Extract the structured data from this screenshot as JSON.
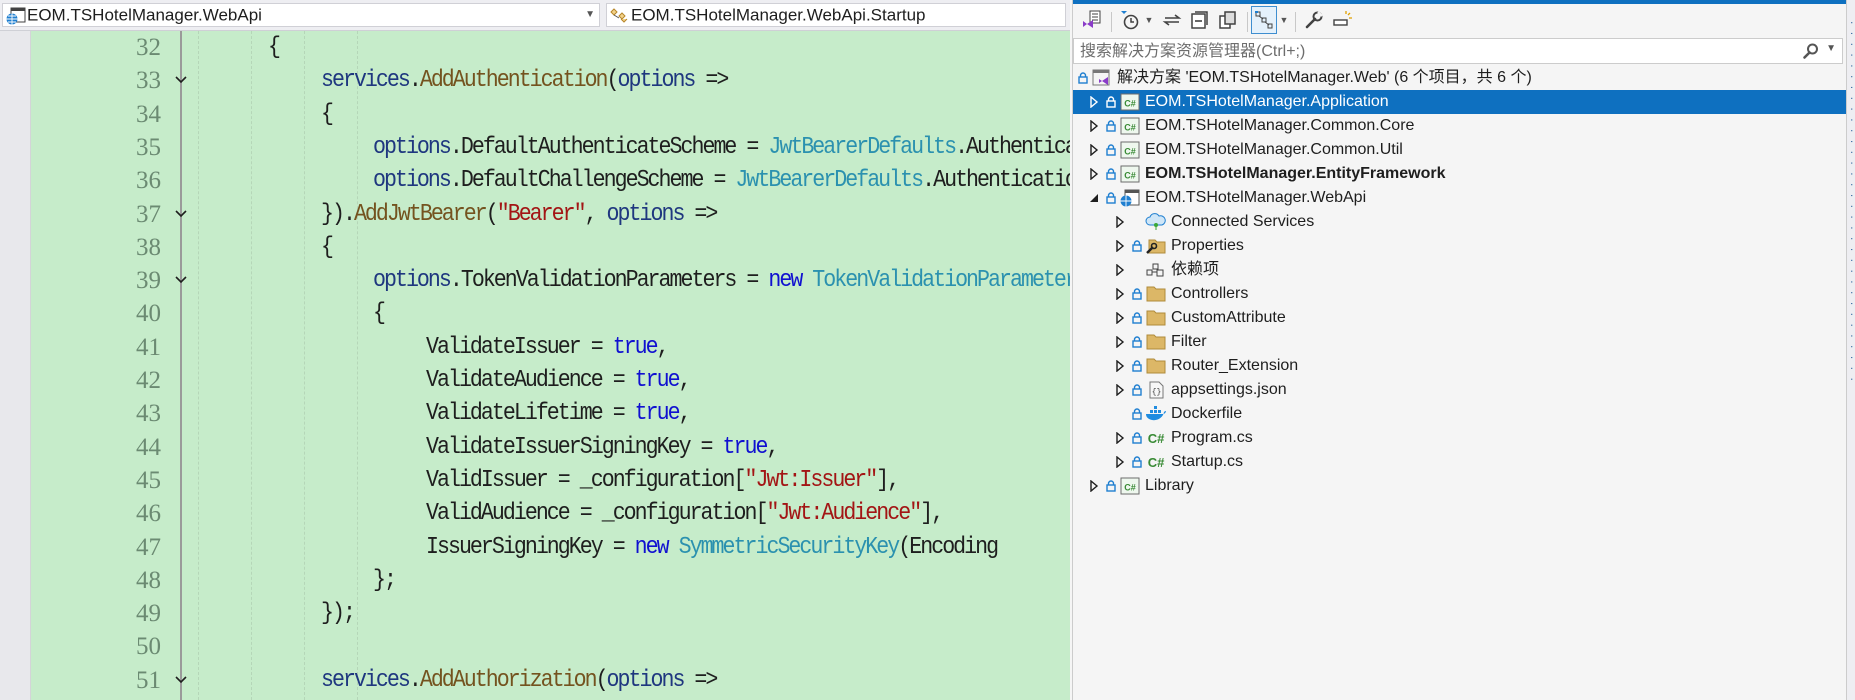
{
  "editor": {
    "nav": {
      "project": "EOM.TSHotelManager.WebApi",
      "class": "EOM.TSHotelManager.WebApi.Startup"
    },
    "lines": [
      {
        "n": "32",
        "fold": false,
        "indent": 3,
        "tokens": [
          {
            "c": "p",
            "t": "{"
          }
        ]
      },
      {
        "n": "33",
        "fold": true,
        "indent": 4,
        "tokens": [
          {
            "c": "v",
            "t": "services"
          },
          {
            "c": "p",
            "t": "."
          },
          {
            "c": "m",
            "t": "AddAuthentication"
          },
          {
            "c": "p",
            "t": "("
          },
          {
            "c": "v",
            "t": "options"
          },
          {
            "c": "p",
            "t": " =>"
          }
        ]
      },
      {
        "n": "34",
        "fold": false,
        "indent": 4,
        "tokens": [
          {
            "c": "p",
            "t": "{"
          }
        ]
      },
      {
        "n": "35",
        "fold": false,
        "indent": 5,
        "tokens": [
          {
            "c": "v",
            "t": "options"
          },
          {
            "c": "p",
            "t": ".DefaultAuthenticateScheme = "
          },
          {
            "c": "t",
            "t": "JwtBearerDefaults"
          },
          {
            "c": "p",
            "t": ".AuthenticationScheme;"
          }
        ]
      },
      {
        "n": "36",
        "fold": false,
        "indent": 5,
        "tokens": [
          {
            "c": "v",
            "t": "options"
          },
          {
            "c": "p",
            "t": ".DefaultChallengeScheme = "
          },
          {
            "c": "t",
            "t": "JwtBearerDefaults"
          },
          {
            "c": "p",
            "t": ".AuthenticationScheme;"
          }
        ]
      },
      {
        "n": "37",
        "fold": true,
        "indent": 4,
        "tokens": [
          {
            "c": "p",
            "t": "})."
          },
          {
            "c": "m",
            "t": "AddJwtBearer"
          },
          {
            "c": "p",
            "t": "("
          },
          {
            "c": "s",
            "t": "\"Bearer\""
          },
          {
            "c": "p",
            "t": ", "
          },
          {
            "c": "v",
            "t": "options"
          },
          {
            "c": "p",
            "t": " =>"
          }
        ]
      },
      {
        "n": "38",
        "fold": false,
        "indent": 4,
        "tokens": [
          {
            "c": "p",
            "t": "{"
          }
        ]
      },
      {
        "n": "39",
        "fold": true,
        "indent": 5,
        "tokens": [
          {
            "c": "v",
            "t": "options"
          },
          {
            "c": "p",
            "t": ".TokenValidationParameters = "
          },
          {
            "c": "k",
            "t": "new"
          },
          {
            "c": "p",
            "t": " "
          },
          {
            "c": "t",
            "t": "TokenValidationParameters"
          }
        ]
      },
      {
        "n": "40",
        "fold": false,
        "indent": 5,
        "tokens": [
          {
            "c": "p",
            "t": "{"
          }
        ]
      },
      {
        "n": "41",
        "fold": false,
        "indent": 6,
        "tokens": [
          {
            "c": "p",
            "t": "ValidateIssuer = "
          },
          {
            "c": "k",
            "t": "true"
          },
          {
            "c": "p",
            "t": ","
          }
        ]
      },
      {
        "n": "42",
        "fold": false,
        "indent": 6,
        "tokens": [
          {
            "c": "p",
            "t": "ValidateAudience = "
          },
          {
            "c": "k",
            "t": "true"
          },
          {
            "c": "p",
            "t": ","
          }
        ]
      },
      {
        "n": "43",
        "fold": false,
        "indent": 6,
        "tokens": [
          {
            "c": "p",
            "t": "ValidateLifetime = "
          },
          {
            "c": "k",
            "t": "true"
          },
          {
            "c": "p",
            "t": ","
          }
        ]
      },
      {
        "n": "44",
        "fold": false,
        "indent": 6,
        "tokens": [
          {
            "c": "p",
            "t": "ValidateIssuerSigningKey = "
          },
          {
            "c": "k",
            "t": "true"
          },
          {
            "c": "p",
            "t": ","
          }
        ]
      },
      {
        "n": "45",
        "fold": false,
        "indent": 6,
        "tokens": [
          {
            "c": "p",
            "t": "ValidIssuer = _configuration["
          },
          {
            "c": "s",
            "t": "\"Jwt:Issuer\""
          },
          {
            "c": "p",
            "t": "],"
          }
        ]
      },
      {
        "n": "46",
        "fold": false,
        "indent": 6,
        "tokens": [
          {
            "c": "p",
            "t": "ValidAudience = _configuration["
          },
          {
            "c": "s",
            "t": "\"Jwt:Audience\""
          },
          {
            "c": "p",
            "t": "],"
          }
        ]
      },
      {
        "n": "47",
        "fold": false,
        "indent": 6,
        "tokens": [
          {
            "c": "p",
            "t": "IssuerSigningKey = "
          },
          {
            "c": "k",
            "t": "new"
          },
          {
            "c": "p",
            "t": " "
          },
          {
            "c": "t",
            "t": "SymmetricSecurityKey"
          },
          {
            "c": "p",
            "t": "(Encoding"
          }
        ]
      },
      {
        "n": "48",
        "fold": false,
        "indent": 5,
        "tokens": [
          {
            "c": "p",
            "t": "};"
          }
        ]
      },
      {
        "n": "49",
        "fold": false,
        "indent": 4,
        "tokens": [
          {
            "c": "p",
            "t": "});"
          }
        ]
      },
      {
        "n": "50",
        "fold": false,
        "indent": 4,
        "tokens": []
      },
      {
        "n": "51",
        "fold": true,
        "indent": 4,
        "tokens": [
          {
            "c": "v",
            "t": "services"
          },
          {
            "c": "p",
            "t": "."
          },
          {
            "c": "m",
            "t": "AddAuthorization"
          },
          {
            "c": "p",
            "t": "("
          },
          {
            "c": "v",
            "t": "options"
          },
          {
            "c": "p",
            "t": " =>"
          }
        ]
      }
    ]
  },
  "solution_explorer": {
    "search_placeholder": "搜索解决方案资源管理器(Ctrl+;)",
    "toolbar": [
      {
        "name": "switch-views-icon"
      },
      {
        "name": "pending-changes-filter-icon"
      },
      {
        "name": "sync-with-active-document-icon"
      },
      {
        "name": "collapse-all-icon"
      },
      {
        "name": "show-all-files-icon"
      },
      {
        "name": "code-map-icon"
      },
      {
        "name": "properties-icon"
      },
      {
        "name": "preview-selected-items-icon"
      }
    ],
    "items": [
      {
        "label": "解决方案 'EOM.TSHotelManager.Web' (6 个项目，共 6 个)",
        "level": 0,
        "expander": "none",
        "lock": true,
        "icon": "solution",
        "bold": false,
        "selected": false
      },
      {
        "label": "EOM.TSHotelManager.Application",
        "level": 1,
        "expander": "collapsed",
        "lock": true,
        "icon": "csproj",
        "bold": false,
        "selected": true
      },
      {
        "label": "EOM.TSHotelManager.Common.Core",
        "level": 1,
        "expander": "collapsed",
        "lock": true,
        "icon": "csproj",
        "bold": false,
        "selected": false
      },
      {
        "label": "EOM.TSHotelManager.Common.Util",
        "level": 1,
        "expander": "collapsed",
        "lock": true,
        "icon": "csproj",
        "bold": false,
        "selected": false
      },
      {
        "label": "EOM.TSHotelManager.EntityFramework",
        "level": 1,
        "expander": "collapsed",
        "lock": true,
        "icon": "csproj",
        "bold": true,
        "selected": false
      },
      {
        "label": "EOM.TSHotelManager.WebApi",
        "level": 1,
        "expander": "expanded",
        "lock": true,
        "icon": "webproj",
        "bold": false,
        "selected": false
      },
      {
        "label": "Connected Services",
        "level": 2,
        "expander": "collapsed",
        "lock": false,
        "icon": "connected",
        "bold": false,
        "selected": false
      },
      {
        "label": "Properties",
        "level": 2,
        "expander": "collapsed",
        "lock": true,
        "icon": "properties",
        "bold": false,
        "selected": false
      },
      {
        "label": "依赖项",
        "level": 2,
        "expander": "collapsed",
        "lock": false,
        "icon": "dependencies",
        "bold": false,
        "selected": false
      },
      {
        "label": "Controllers",
        "level": 2,
        "expander": "collapsed",
        "lock": true,
        "icon": "folder",
        "bold": false,
        "selected": false
      },
      {
        "label": "CustomAttribute",
        "level": 2,
        "expander": "collapsed",
        "lock": true,
        "icon": "folder",
        "bold": false,
        "selected": false
      },
      {
        "label": "Filter",
        "level": 2,
        "expander": "collapsed",
        "lock": true,
        "icon": "folder",
        "bold": false,
        "selected": false
      },
      {
        "label": "Router_Extension",
        "level": 2,
        "expander": "collapsed",
        "lock": true,
        "icon": "folder",
        "bold": false,
        "selected": false
      },
      {
        "label": "appsettings.json",
        "level": 2,
        "expander": "collapsed",
        "lock": true,
        "icon": "json",
        "bold": false,
        "selected": false
      },
      {
        "label": "Dockerfile",
        "level": 2,
        "expander": "none",
        "lock": true,
        "icon": "docker",
        "bold": false,
        "selected": false
      },
      {
        "label": "Program.cs",
        "level": 2,
        "expander": "collapsed",
        "lock": true,
        "icon": "csfile",
        "bold": false,
        "selected": false
      },
      {
        "label": "Startup.cs",
        "level": 2,
        "expander": "collapsed",
        "lock": true,
        "icon": "csfile",
        "bold": false,
        "selected": false
      },
      {
        "label": "Library",
        "level": 1,
        "expander": "collapsed",
        "lock": true,
        "icon": "csproj",
        "bold": false,
        "selected": false
      }
    ]
  },
  "colors": {
    "editor_background": "#c6ecca",
    "selection": "#0e70c0",
    "keyword": "#1010d0",
    "type": "#2b91af",
    "method": "#74531f",
    "string": "#a31515"
  }
}
